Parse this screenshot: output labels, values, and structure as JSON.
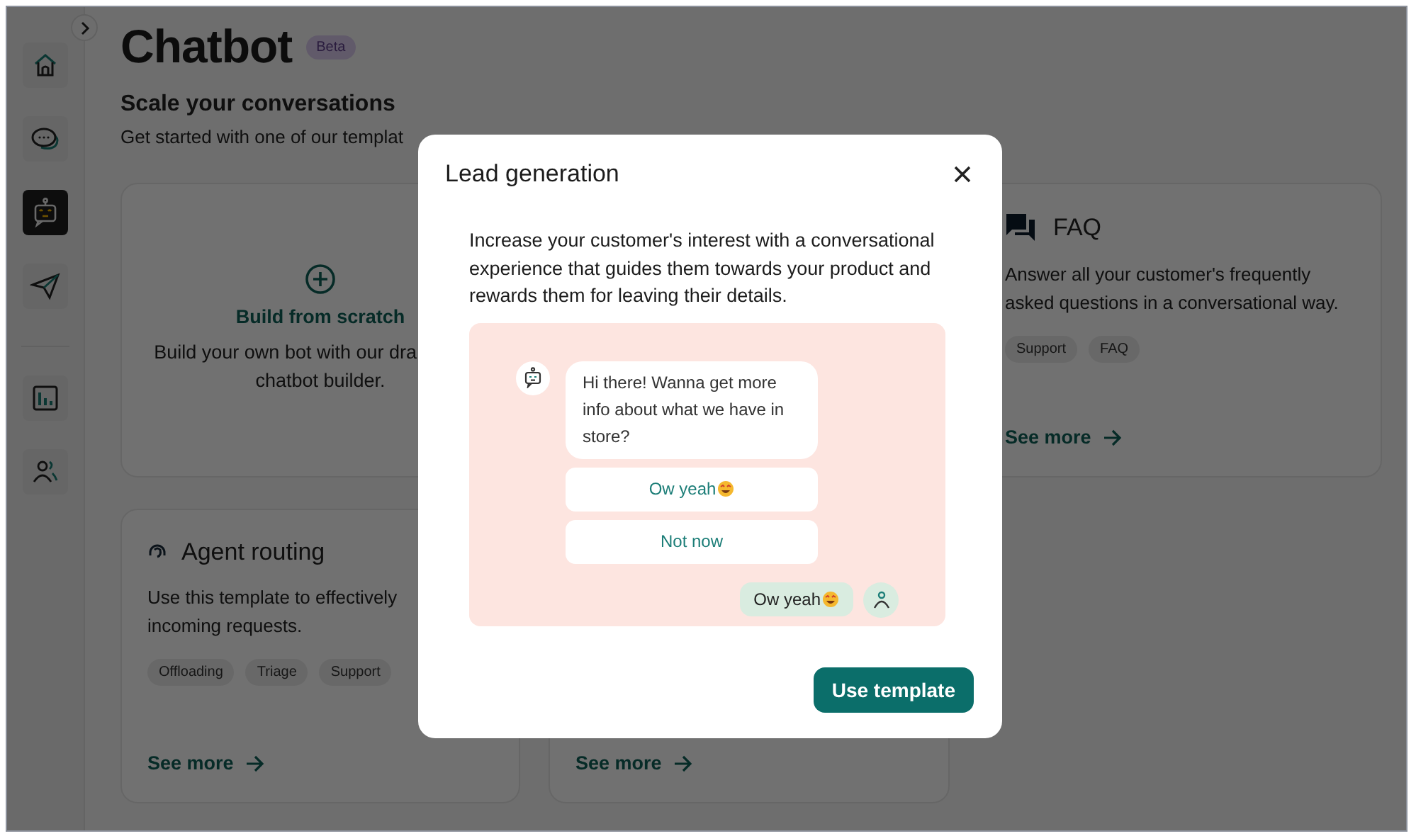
{
  "sidebar": {
    "items": [
      {
        "kind": "home",
        "selected": false
      },
      {
        "kind": "chat",
        "selected": false
      },
      {
        "kind": "bot",
        "selected": true
      },
      {
        "kind": "send",
        "selected": false
      },
      {
        "kind": "stats",
        "selected": false
      },
      {
        "kind": "people",
        "selected": false
      }
    ]
  },
  "page": {
    "title": "Chatbot",
    "badge": "Beta",
    "subtitle": "Scale your conversations",
    "intro": "Get started with one of our templat"
  },
  "templates": [
    {
      "kind": "scratch",
      "title": "Build from scratch",
      "lines": [
        "Build your own bot with our dra",
        "chatbot builder."
      ]
    },
    {
      "kind": "faq",
      "title": "FAQ",
      "lines": [
        "Answer all your customer's frequently",
        "asked questions in a conversational way."
      ],
      "tags": [
        "Support",
        "FAQ"
      ],
      "link": "See more"
    },
    {
      "kind": "routing",
      "title": "Agent routing",
      "lines": [
        "Use this template to effectively",
        "incoming requests."
      ],
      "tags": [
        "Offloading",
        "Triage",
        "Support"
      ],
      "link": "See more"
    },
    {
      "kind": "covered",
      "link": "See more"
    }
  ],
  "modal": {
    "title": "Lead generation",
    "description": "Increase your customer's interest with a conversational experience that guides them towards your product and rewards them for leaving their details.",
    "preview": {
      "bot_message": "Hi there! Wanna get more info about what we have in store?",
      "options": [
        "Ow yeah",
        "Not now"
      ],
      "user_message": "Ow yeah"
    },
    "button": "Use template"
  }
}
